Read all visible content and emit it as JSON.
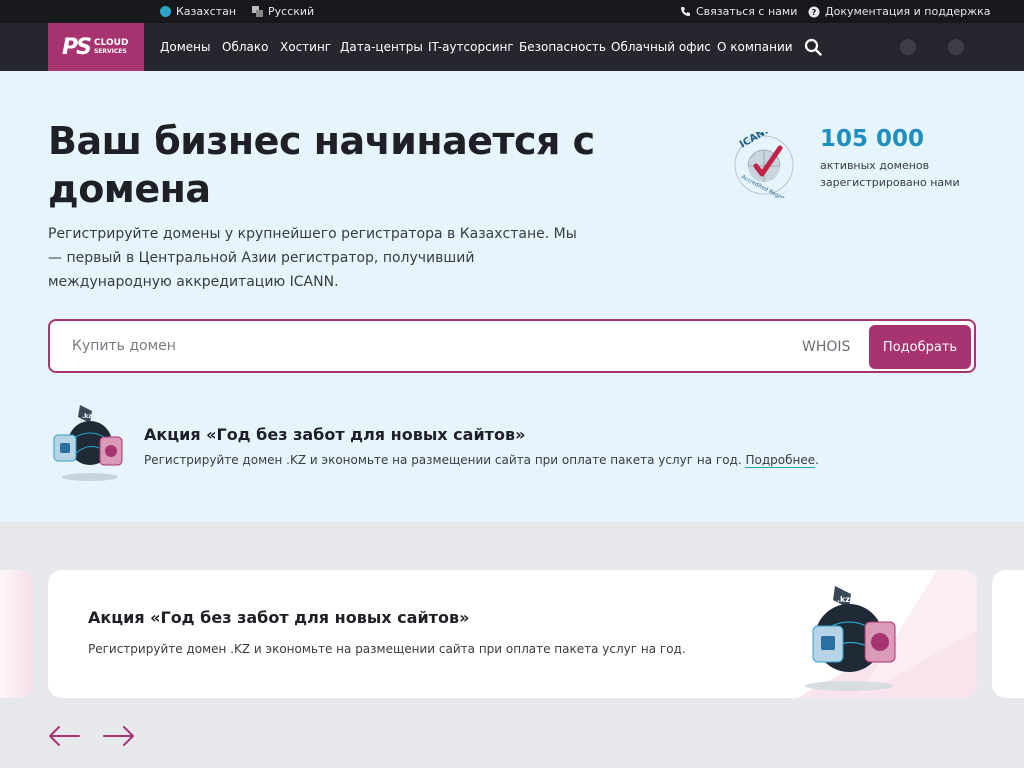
{
  "topbar": {
    "region": "Казахстан",
    "language": "Русский",
    "contact": "Связаться с нами",
    "docs": "Документация и поддержка"
  },
  "logo": {
    "mark": "PS",
    "line1": "CLOUD",
    "line2": "SERVICES"
  },
  "nav": {
    "items": [
      "Домены",
      "Облако",
      "Хостинг",
      "Дата-центры",
      "IT-аутсорсинг",
      "Безопасность",
      "Облачный офис",
      "О компании"
    ]
  },
  "hero": {
    "title": "Ваш бизнес начинается с домена",
    "description": "Регистрируйте домены у крупнейшего регистратора в Казахстане. Мы — первый в Центральной Азии регистратор, получивший международную аккредитацию ICANN.",
    "stat_number": "105 000",
    "stat_label": "активных доменов зарегистрировано нами",
    "icann_text": "ICANN",
    "icann_sub": "Accredited Registrar"
  },
  "search": {
    "placeholder": "Купить домен",
    "whois_label": "WHOIS",
    "submit_label": "Подобрать"
  },
  "promo": {
    "title": "Акция «Год без забот для новых сайтов»",
    "text": "Регистрируйте домен .KZ и экономьте на размещении сайта при оплате пакета услуг на год.",
    "more": "Подробнее",
    "tail": "."
  },
  "carousel": {
    "title": "Акция «Год без забот для новых сайтов»",
    "text": "Регистрируйте домен .KZ и экономьте на размещении сайта при оплате пакета услуг на год."
  },
  "colors": {
    "brand": "#a73471",
    "accent": "#1f8fc0",
    "hero_bg": "#e6f5fb"
  },
  "icons": [
    "kz-flag-icon",
    "translate-icon",
    "phone-icon",
    "help-icon",
    "search-icon",
    "arrow-left-icon",
    "arrow-right-icon"
  ]
}
